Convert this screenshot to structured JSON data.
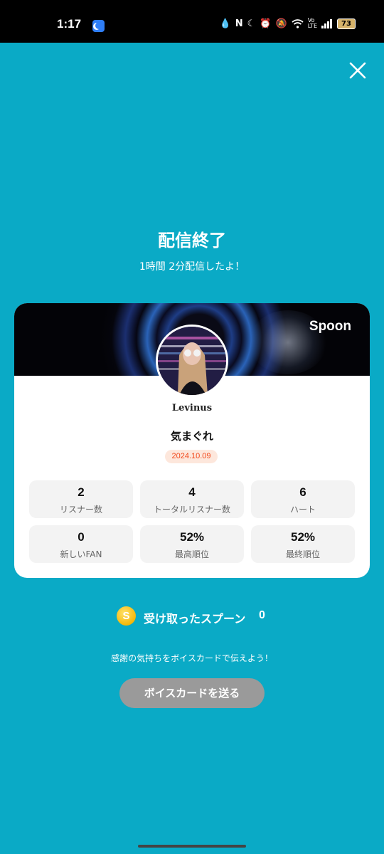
{
  "status_bar": {
    "time": "1:17",
    "icons": [
      "water-drop-icon",
      "nfc-icon",
      "moon-icon",
      "alarm-icon",
      "mute-icon",
      "wifi-icon",
      "volte-icon",
      "signal-icon"
    ],
    "battery": "73"
  },
  "header": {
    "title": "配信終了",
    "subtitle": "1時間 2分配信したよ！"
  },
  "card": {
    "brand": "Spoon",
    "username": "Levinus",
    "stream_title": "気まぐれ",
    "date": "2024.10.09",
    "stats": [
      {
        "value": "2",
        "label": "リスナー数"
      },
      {
        "value": "4",
        "label": "トータルリスナー数"
      },
      {
        "value": "6",
        "label": "ハート"
      },
      {
        "value": "0",
        "label": "新しいFAN"
      },
      {
        "value": "52%",
        "label": "最高順位"
      },
      {
        "value": "52%",
        "label": "最終順位"
      }
    ]
  },
  "spoons": {
    "coin_symbol": "S",
    "label": "受け取ったスプーン",
    "count": "0"
  },
  "footer": {
    "thanks_text": "感謝の気持ちをボイスカードで伝えよう！",
    "voice_card_button": "ボイスカードを送る"
  },
  "colors": {
    "background": "#0aaac6",
    "date_badge_text": "#f24a1d",
    "button_disabled": "#9a9a9a"
  }
}
